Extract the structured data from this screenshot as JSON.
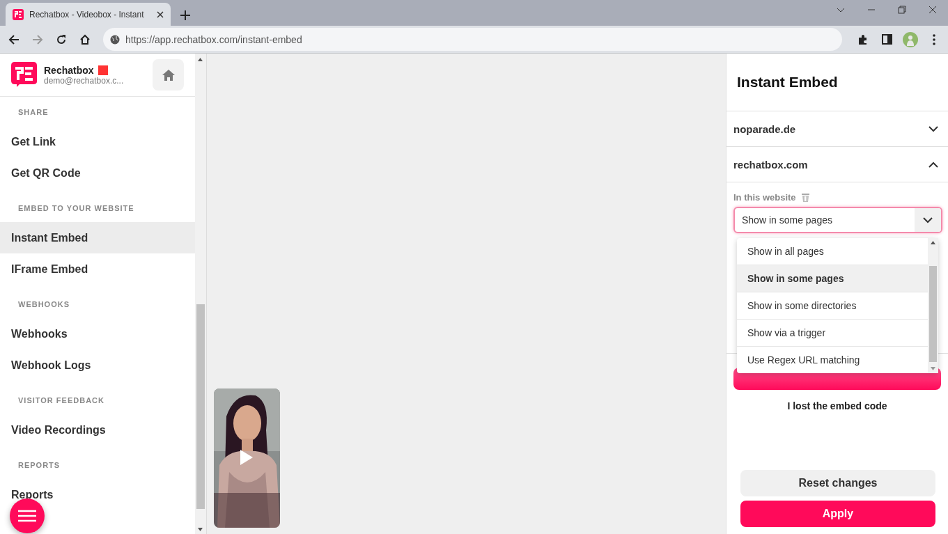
{
  "browser": {
    "tab_title": "Rechatbox - Videobox - Instant",
    "url": "https://app.rechatbox.com/instant-embed"
  },
  "sidebar": {
    "brand": "Rechatbox",
    "email": "demo@rechatbox.c...",
    "sections": [
      {
        "heading": "SHARE",
        "items": [
          {
            "label": "Get Link",
            "selected": false
          },
          {
            "label": "Get QR Code",
            "selected": false
          }
        ]
      },
      {
        "heading": "EMBED TO YOUR WEBSITE",
        "items": [
          {
            "label": "Instant Embed",
            "selected": true
          },
          {
            "label": "IFrame Embed",
            "selected": false
          }
        ]
      },
      {
        "heading": "WEBHOOKS",
        "items": [
          {
            "label": "Webhooks",
            "selected": false
          },
          {
            "label": "Webhook Logs",
            "selected": false
          }
        ]
      },
      {
        "heading": "VISITOR FEEDBACK",
        "items": [
          {
            "label": "Video Recordings",
            "selected": false
          }
        ]
      },
      {
        "heading": "REPORTS",
        "items": [
          {
            "label": "Reports",
            "selected": false
          }
        ]
      }
    ]
  },
  "panel": {
    "title": "Instant Embed",
    "websites": [
      {
        "domain": "noparade.de",
        "expanded": false
      },
      {
        "domain": "rechatbox.com",
        "expanded": true
      }
    ],
    "field_label": "In this website",
    "select_value": "Show in some pages",
    "options": [
      {
        "label": "Show in all pages",
        "selected": false
      },
      {
        "label": "Show in some pages",
        "selected": true
      },
      {
        "label": "Show in some directories",
        "selected": false
      },
      {
        "label": "Show via a trigger",
        "selected": false
      },
      {
        "label": "Use Regex URL matching",
        "selected": false
      }
    ],
    "lost_code_link": "I lost the embed code",
    "buttons": [
      {
        "label": "Reset changes",
        "kind": "secondary"
      },
      {
        "label": "Apply",
        "kind": "primary"
      }
    ]
  }
}
